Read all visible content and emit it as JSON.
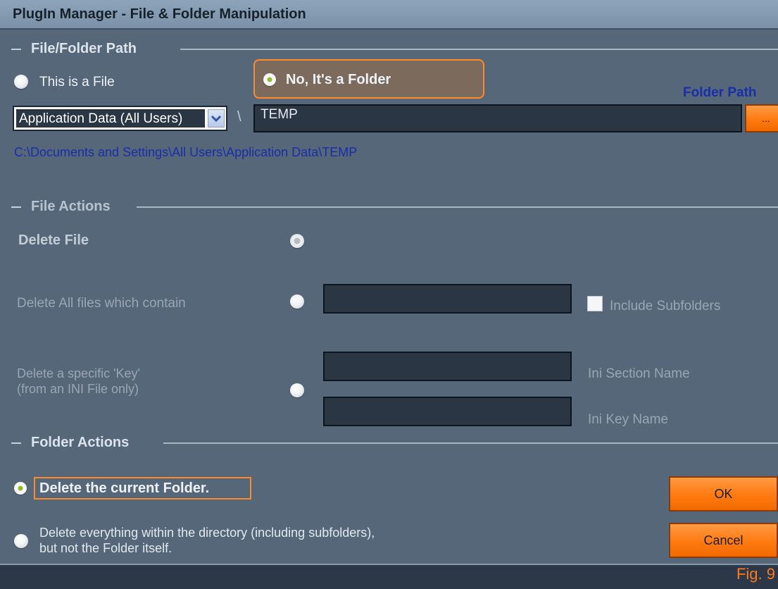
{
  "window": {
    "title": "PlugIn Manager - File & Folder Manipulation"
  },
  "path_section": {
    "title": "File/Folder Path",
    "option_file": "This is a File",
    "option_folder": "No, It's a Folder",
    "folder_path_label": "Folder Path",
    "dropdown_value": "Application Data (All Users)",
    "separator": "\\",
    "path_value": "TEMP",
    "browse_label": "...",
    "resolved_path": "C:\\Documents and Settings\\All Users\\Application Data\\TEMP"
  },
  "file_actions": {
    "title": "File Actions",
    "delete_file": "Delete File",
    "delete_containing": "Delete All files which contain",
    "include_subfolders": "Include Subfolders",
    "delete_key_line1": "Delete a specific 'Key'",
    "delete_key_line2": "(from an INI File only)",
    "ini_section": "Ini Section Name",
    "ini_key": "Ini Key Name"
  },
  "folder_actions": {
    "title": "Folder Actions",
    "delete_folder": "Delete the current Folder.",
    "delete_contents_line1": "Delete everything within the directory (including subfolders),",
    "delete_contents_line2": "but not the Folder itself."
  },
  "buttons": {
    "ok": "OK",
    "cancel": "Cancel"
  },
  "caption": "Fig. 9",
  "colors": {
    "accent": "#ff7a10",
    "link": "#1a2ea8",
    "background": "#56677a"
  }
}
